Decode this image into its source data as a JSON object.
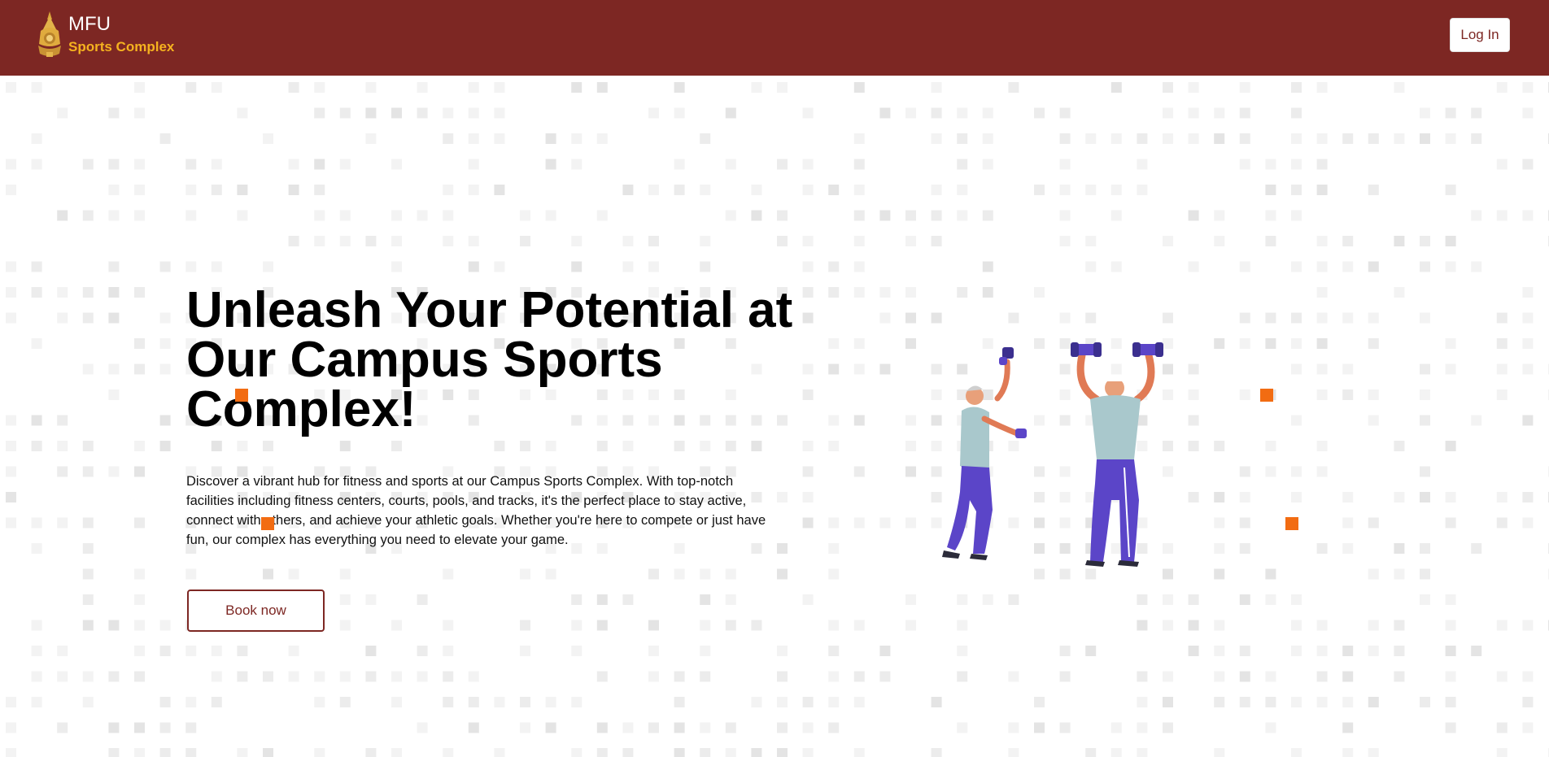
{
  "header": {
    "brand_title": "MFU",
    "brand_subtitle": "Sports Complex",
    "login_label": "Log In",
    "logo_icon": "university-crest-icon"
  },
  "hero": {
    "title": "Unleash Your Potential at Our Campus Sports Complex!",
    "description": "Discover a vibrant hub for fitness and sports at our Campus Sports Complex. With top-notch facilities including fitness centers, courts, pools, and tracks, it's the perfect place to stay active, connect with others, and achieve your athletic goals. Whether you're here to compete or just have fun, our complex has everything you need to elevate your game.",
    "cta_label": "Book now",
    "illustration_icon": "exercising-people-illustration"
  },
  "colors": {
    "header_bg": "#7d2723",
    "brand_subtitle": "#f5b21f",
    "accent_square": "#f26c12",
    "grid_square": "#ededed",
    "figure_purple": "#5b45c8",
    "figure_shirt": "#a9c8cc"
  }
}
